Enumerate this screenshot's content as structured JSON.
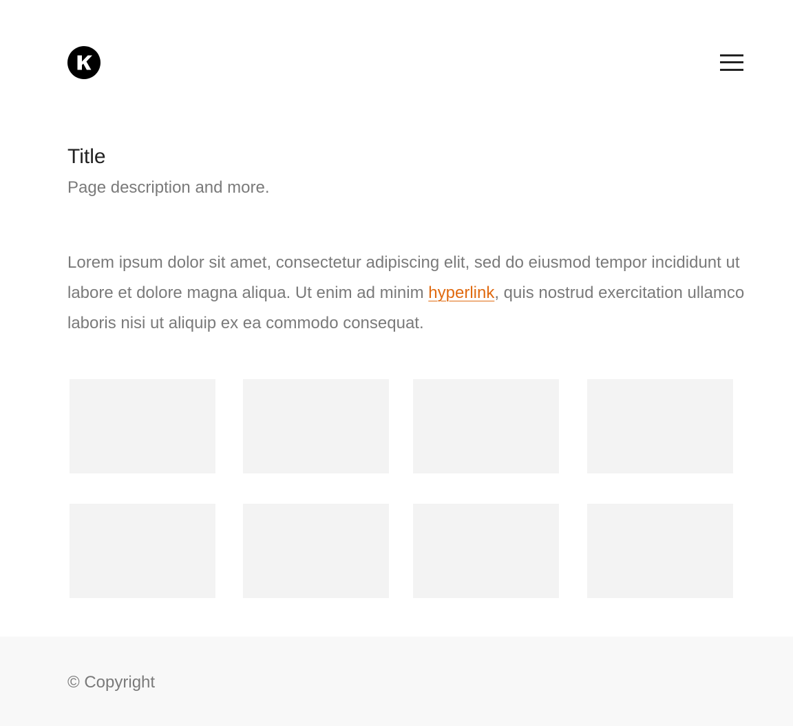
{
  "header": {
    "logo_icon": "k-logo-icon",
    "menu_icon": "hamburger-menu-icon"
  },
  "page": {
    "title": "Title",
    "description": "Page description and more."
  },
  "body": {
    "text_before_link": "Lorem ipsum dolor sit amet, consectetur adipiscing elit, sed do eiusmod tempor incididunt ut labore et dolore magna aliqua. Ut enim ad minim ",
    "link_text": "hyperlink",
    "text_after_link": ", quis nostrud exercitation ullamco laboris nisi ut aliquip ex ea commodo consequat."
  },
  "grid": {
    "rows": 2,
    "columns": 4,
    "card_color": "#f3f3f3"
  },
  "footer": {
    "copyright": "© Copyright"
  },
  "colors": {
    "link": "#e06a10",
    "text": "#7a7a7a",
    "heading": "#222222",
    "footer_bg": "#f8f8f8"
  }
}
